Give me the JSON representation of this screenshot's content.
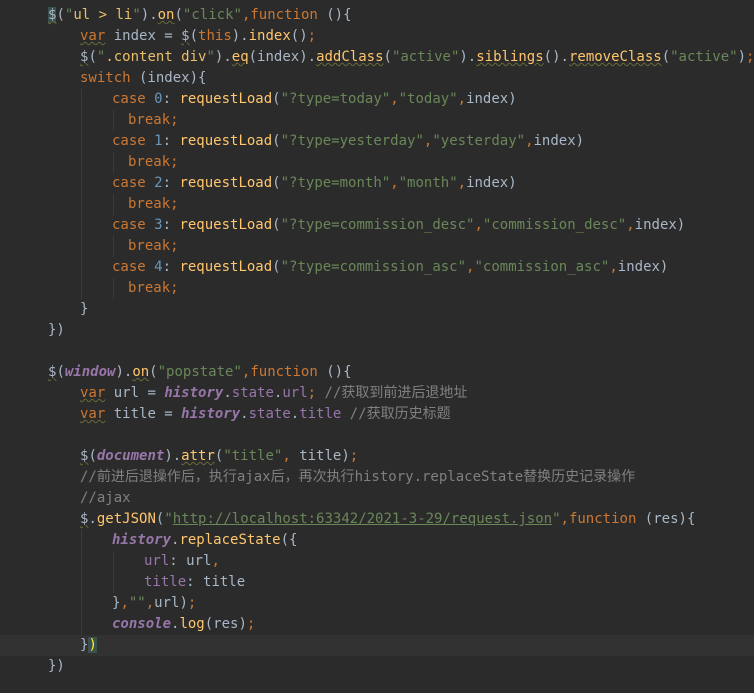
{
  "editor": {
    "lines": [
      [
        {
          "t": "$",
          "c": "hl-dollar tok-sq"
        },
        {
          "t": "(",
          "c": ""
        },
        {
          "t": "\"",
          "c": "tok-str"
        },
        {
          "t": "ul > li",
          "c": "tok-sel"
        },
        {
          "t": "\"",
          "c": "tok-str"
        },
        {
          "t": ").",
          "c": ""
        },
        {
          "t": "on",
          "c": "tok-fn tok-sq"
        },
        {
          "t": "(",
          "c": ""
        },
        {
          "t": "\"click\"",
          "c": "tok-str"
        },
        {
          "t": ",",
          "c": "tok-kw"
        },
        {
          "t": "function",
          "c": "tok-kw"
        },
        {
          "t": " (){",
          "c": ""
        }
      ],
      [
        {
          "t": "var",
          "c": "tok-kw tok-sq"
        },
        {
          "t": " index = ",
          "c": ""
        },
        {
          "t": "$",
          "c": "tok-sq"
        },
        {
          "t": "(",
          "c": ""
        },
        {
          "t": "this",
          "c": "tok-kw"
        },
        {
          "t": ").",
          "c": ""
        },
        {
          "t": "index",
          "c": "tok-fn"
        },
        {
          "t": "()",
          "c": ""
        },
        {
          "t": ";",
          "c": "tok-kw"
        }
      ],
      [
        {
          "t": "$",
          "c": "tok-sq"
        },
        {
          "t": "(",
          "c": ""
        },
        {
          "t": "\"",
          "c": "tok-str"
        },
        {
          "t": ".content div",
          "c": "tok-sel"
        },
        {
          "t": "\"",
          "c": "tok-str"
        },
        {
          "t": ").",
          "c": ""
        },
        {
          "t": "eq",
          "c": "tok-fn tok-sq"
        },
        {
          "t": "(index).",
          "c": ""
        },
        {
          "t": "addClass",
          "c": "tok-fn tok-sq"
        },
        {
          "t": "(",
          "c": ""
        },
        {
          "t": "\"active\"",
          "c": "tok-str"
        },
        {
          "t": ").",
          "c": ""
        },
        {
          "t": "siblings",
          "c": "tok-fn tok-sq"
        },
        {
          "t": "().",
          "c": ""
        },
        {
          "t": "removeClass",
          "c": "tok-fn tok-sq"
        },
        {
          "t": "(",
          "c": ""
        },
        {
          "t": "\"active\"",
          "c": "tok-str"
        },
        {
          "t": ")",
          "c": ""
        },
        {
          "t": ";",
          "c": "tok-kw"
        }
      ],
      [
        {
          "t": "switch",
          "c": "tok-kw"
        },
        {
          "t": " (index){",
          "c": ""
        }
      ],
      [
        {
          "t": "case ",
          "c": "tok-kw"
        },
        {
          "t": "0",
          "c": "tok-num"
        },
        {
          "t": ": ",
          "c": ""
        },
        {
          "t": "requestLoad",
          "c": "tok-fn"
        },
        {
          "t": "(",
          "c": ""
        },
        {
          "t": "\"?type=today\"",
          "c": "tok-str"
        },
        {
          "t": ",",
          "c": "tok-kw"
        },
        {
          "t": "\"today\"",
          "c": "tok-str"
        },
        {
          "t": ",",
          "c": "tok-kw"
        },
        {
          "t": "index)",
          "c": ""
        }
      ],
      [
        {
          "t": "break",
          "c": "tok-kw"
        },
        {
          "t": ";",
          "c": "tok-kw"
        }
      ],
      [
        {
          "t": "case ",
          "c": "tok-kw"
        },
        {
          "t": "1",
          "c": "tok-num"
        },
        {
          "t": ": ",
          "c": ""
        },
        {
          "t": "requestLoad",
          "c": "tok-fn"
        },
        {
          "t": "(",
          "c": ""
        },
        {
          "t": "\"?type=yesterday\"",
          "c": "tok-str"
        },
        {
          "t": ",",
          "c": "tok-kw"
        },
        {
          "t": "\"yesterday\"",
          "c": "tok-str"
        },
        {
          "t": ",",
          "c": "tok-kw"
        },
        {
          "t": "index)",
          "c": ""
        }
      ],
      [
        {
          "t": "break",
          "c": "tok-kw"
        },
        {
          "t": ";",
          "c": "tok-kw"
        }
      ],
      [
        {
          "t": "case ",
          "c": "tok-kw"
        },
        {
          "t": "2",
          "c": "tok-num"
        },
        {
          "t": ": ",
          "c": ""
        },
        {
          "t": "requestLoad",
          "c": "tok-fn"
        },
        {
          "t": "(",
          "c": ""
        },
        {
          "t": "\"?type=month\"",
          "c": "tok-str"
        },
        {
          "t": ",",
          "c": "tok-kw"
        },
        {
          "t": "\"month\"",
          "c": "tok-str"
        },
        {
          "t": ",",
          "c": "tok-kw"
        },
        {
          "t": "index)",
          "c": ""
        }
      ],
      [
        {
          "t": "break",
          "c": "tok-kw"
        },
        {
          "t": ";",
          "c": "tok-kw"
        }
      ],
      [
        {
          "t": "case ",
          "c": "tok-kw"
        },
        {
          "t": "3",
          "c": "tok-num"
        },
        {
          "t": ": ",
          "c": ""
        },
        {
          "t": "requestLoad",
          "c": "tok-fn"
        },
        {
          "t": "(",
          "c": ""
        },
        {
          "t": "\"?type=commission_desc\"",
          "c": "tok-str"
        },
        {
          "t": ",",
          "c": "tok-kw"
        },
        {
          "t": "\"commission_desc\"",
          "c": "tok-str"
        },
        {
          "t": ",",
          "c": "tok-kw"
        },
        {
          "t": "index)",
          "c": ""
        }
      ],
      [
        {
          "t": "break",
          "c": "tok-kw"
        },
        {
          "t": ";",
          "c": "tok-kw"
        }
      ],
      [
        {
          "t": "case ",
          "c": "tok-kw"
        },
        {
          "t": "4",
          "c": "tok-num"
        },
        {
          "t": ": ",
          "c": ""
        },
        {
          "t": "requestLoad",
          "c": "tok-fn"
        },
        {
          "t": "(",
          "c": ""
        },
        {
          "t": "\"?type=commission_asc\"",
          "c": "tok-str"
        },
        {
          "t": ",",
          "c": "tok-kw"
        },
        {
          "t": "\"commission_asc\"",
          "c": "tok-str"
        },
        {
          "t": ",",
          "c": "tok-kw"
        },
        {
          "t": "index)",
          "c": ""
        }
      ],
      [
        {
          "t": "break",
          "c": "tok-kw"
        },
        {
          "t": ";",
          "c": "tok-kw"
        }
      ],
      [
        {
          "t": "}",
          "c": ""
        }
      ],
      [
        {
          "t": "})",
          "c": ""
        }
      ],
      [],
      [
        {
          "t": "$",
          "c": "tok-sq"
        },
        {
          "t": "(",
          "c": ""
        },
        {
          "t": "window",
          "c": "tok-global"
        },
        {
          "t": ").",
          "c": ""
        },
        {
          "t": "on",
          "c": "tok-fn tok-sq"
        },
        {
          "t": "(",
          "c": ""
        },
        {
          "t": "\"popstate\"",
          "c": "tok-str"
        },
        {
          "t": ",",
          "c": "tok-kw"
        },
        {
          "t": "function",
          "c": "tok-kw"
        },
        {
          "t": " (){",
          "c": ""
        }
      ],
      [
        {
          "t": "var",
          "c": "tok-kw tok-sq"
        },
        {
          "t": " url = ",
          "c": ""
        },
        {
          "t": "history",
          "c": "tok-global"
        },
        {
          "t": ".",
          "c": ""
        },
        {
          "t": "state",
          "c": "tok-prop"
        },
        {
          "t": ".",
          "c": ""
        },
        {
          "t": "url",
          "c": "tok-prop"
        },
        {
          "t": "; ",
          "c": "tok-kw"
        },
        {
          "t": "//获取到前进后退地址",
          "c": "tok-cmt"
        }
      ],
      [
        {
          "t": "var",
          "c": "tok-kw tok-sq"
        },
        {
          "t": " title = ",
          "c": ""
        },
        {
          "t": "history",
          "c": "tok-global"
        },
        {
          "t": ".",
          "c": ""
        },
        {
          "t": "state",
          "c": "tok-prop"
        },
        {
          "t": ".",
          "c": ""
        },
        {
          "t": "title",
          "c": "tok-prop"
        },
        {
          "t": " ",
          "c": ""
        },
        {
          "t": "//获取历史标题",
          "c": "tok-cmt"
        }
      ],
      [],
      [
        {
          "t": "$",
          "c": "tok-sq"
        },
        {
          "t": "(",
          "c": ""
        },
        {
          "t": "document",
          "c": "tok-global"
        },
        {
          "t": ").",
          "c": ""
        },
        {
          "t": "attr",
          "c": "tok-fn tok-sq"
        },
        {
          "t": "(",
          "c": ""
        },
        {
          "t": "\"title\"",
          "c": "tok-str"
        },
        {
          "t": ", ",
          "c": "tok-kw"
        },
        {
          "t": "title)",
          "c": ""
        },
        {
          "t": ";",
          "c": "tok-kw"
        }
      ],
      [
        {
          "t": "//前进后退操作后，执行ajax后，再次执行history.replaceState替换历史记录操作",
          "c": "tok-cmt"
        }
      ],
      [
        {
          "t": "//ajax",
          "c": "tok-cmt"
        }
      ],
      [
        {
          "t": "$",
          "c": "tok-sq"
        },
        {
          "t": ".",
          "c": ""
        },
        {
          "t": "getJSON",
          "c": "tok-fn"
        },
        {
          "t": "(",
          "c": ""
        },
        {
          "t": "\"",
          "c": "tok-str"
        },
        {
          "t": "http://localhost:63342/2021-3-29/request.json",
          "c": "tok-link"
        },
        {
          "t": "\"",
          "c": "tok-str"
        },
        {
          "t": ",",
          "c": "tok-kw"
        },
        {
          "t": "function",
          "c": "tok-kw"
        },
        {
          "t": " (res){",
          "c": ""
        }
      ],
      [
        {
          "t": "history",
          "c": "tok-global"
        },
        {
          "t": ".",
          "c": ""
        },
        {
          "t": "replaceState",
          "c": "tok-fn"
        },
        {
          "t": "({",
          "c": ""
        }
      ],
      [
        {
          "t": "url",
          "c": "tok-prop"
        },
        {
          "t": ": url",
          "c": ""
        },
        {
          "t": ",",
          "c": "tok-kw"
        }
      ],
      [
        {
          "t": "title",
          "c": "tok-prop"
        },
        {
          "t": ": title",
          "c": ""
        }
      ],
      [
        {
          "t": "}",
          "c": ""
        },
        {
          "t": ",",
          "c": "tok-kw"
        },
        {
          "t": "\"\"",
          "c": "tok-str"
        },
        {
          "t": ",",
          "c": "tok-kw"
        },
        {
          "t": "url)",
          "c": ""
        },
        {
          "t": ";",
          "c": "tok-kw"
        }
      ],
      [
        {
          "t": "console",
          "c": "tok-global"
        },
        {
          "t": ".",
          "c": ""
        },
        {
          "t": "log",
          "c": "tok-fn"
        },
        {
          "t": "(res)",
          "c": ""
        },
        {
          "t": ";",
          "c": "tok-kw"
        }
      ],
      [
        {
          "t": "}",
          "c": ""
        },
        {
          "t": ")",
          "c": "hl-paren"
        }
      ],
      [
        {
          "t": "})",
          "c": ""
        }
      ]
    ]
  }
}
